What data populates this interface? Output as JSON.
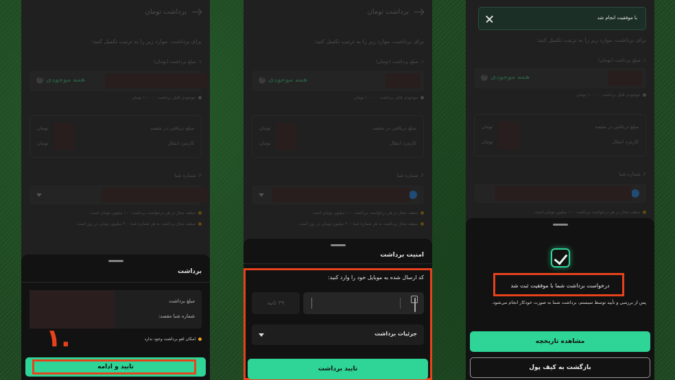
{
  "form": {
    "title": "برداشت تومان",
    "instructions": "برای برداشت، موارد زیر را به ترتیب تکمیل کنید:",
    "amount_label": "۱. مبلغ برداشت (تومان)",
    "all_balance": "همه موجودی",
    "withdrawable_hint": "موجودی قابل برداشت ۱۰۰۰۰۰ تومان",
    "receive_label": "مبلغ دریافتی در مقصد",
    "fee_label": "کارمزد انتقال",
    "currency": "تومان",
    "sheba_label": "۲. شماره شبا",
    "limit_note_1": "سقف مجاز در هر درخواست برداشت ۱۰۰ میلیون تومان است.",
    "limit_note_2": "سقف مجاز برداشت به هر شماره شبا ۲۰۰ میلیون تومان در روز است."
  },
  "panel1": {
    "sheet_title": "برداشت",
    "amount_label": "مبلغ برداشت",
    "sheba_dest_label": "شماره شبا مقصد:",
    "cancel_note": "امکان لغو برداشت وجود ندارد",
    "confirm_button": "تایید و ادامه",
    "step_number": "۱."
  },
  "panel2": {
    "sheet_title": "امنیت برداشت",
    "code_prompt": "کد ارسال شده به موبایل خود را وارد کنید:",
    "timer": "۳۹ ثانیه",
    "details_label": "جزئیات برداشت",
    "confirm_button": "تایید برداشت"
  },
  "panel3": {
    "toast": "با موفقیت انجام شد",
    "success_title": "درخواست برداشت شما با موفقیت ثبت شد",
    "success_desc": "پس از بررسی و تأیید توسط سیستم، برداشت شما به صورت خودکار انجام می‌شود.",
    "history_button": "مشاهده تاریخچه",
    "back_button": "بازگشت به کیف پول"
  },
  "colors": {
    "accent": "#2fd596",
    "highlight": "#e8421c",
    "sheet_bg": "#121212",
    "page_bg": "#2e2e2e"
  }
}
